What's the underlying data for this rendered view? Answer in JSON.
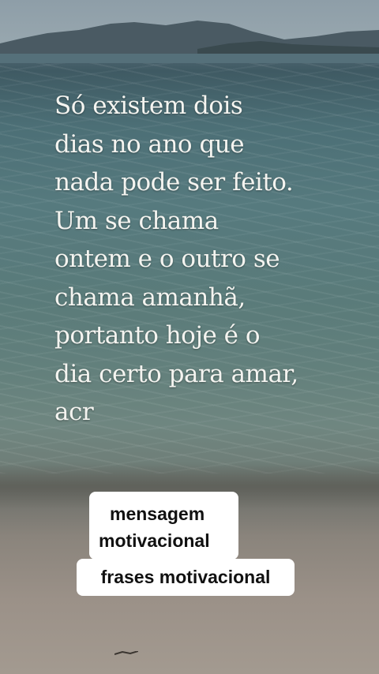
{
  "quote": {
    "lines": [
      "Só existem dois",
      "dias no ano que",
      "nada pode ser feito.",
      "Um se chama",
      "ontem e o outro se",
      "chama amanhã,",
      "portanto hoje é o",
      "dia certo para amar,",
      "acr"
    ]
  },
  "tags": {
    "tag1_line1": "mensagem",
    "tag1_line2": "motivacional",
    "tag2": "frases motivacional"
  },
  "colors": {
    "text": "#f4f4f0",
    "tag_background": "#ffffff",
    "tag_text": "#111111"
  }
}
